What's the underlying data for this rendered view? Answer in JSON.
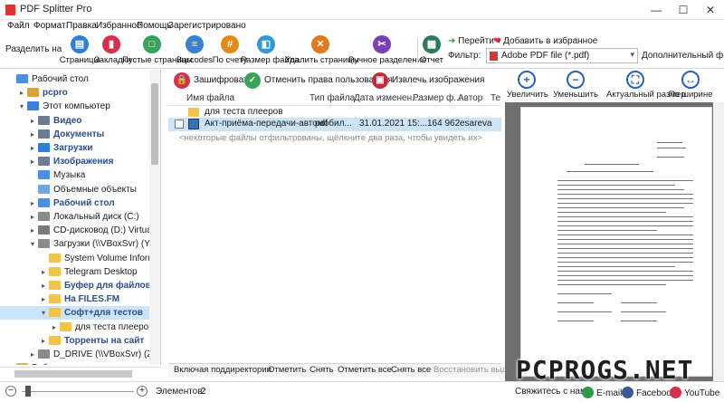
{
  "window": {
    "title": "PDF Splitter Pro"
  },
  "menu": [
    "Файл",
    "Формат",
    "Правка",
    "Избранное",
    "Помощь",
    "Зарегистрировано"
  ],
  "toolbar": {
    "split_by": "Разделить на",
    "buttons": [
      {
        "label": "Страницы",
        "color": "#2e7fd6",
        "icon": "pages-icon",
        "glyph": "▤"
      },
      {
        "label": "Закладки",
        "color": "#d8304b",
        "icon": "bookmark-icon",
        "glyph": "▮"
      },
      {
        "label": "Пустые страницы",
        "color": "#3aa35a",
        "icon": "blank-pages-icon",
        "glyph": "□"
      },
      {
        "label": "Barcodes",
        "color": "#3a7fd0",
        "icon": "barcode-icon",
        "glyph": "≡"
      },
      {
        "label": "По счету",
        "color": "#e28b1a",
        "icon": "count-icon",
        "glyph": "#"
      },
      {
        "label": "Размер файла",
        "color": "#2e9bd6",
        "icon": "file-size-icon",
        "glyph": "◧"
      },
      {
        "label": "Удалить страницы",
        "color": "#e07a1c",
        "icon": "delete-pages-icon",
        "glyph": "✕"
      },
      {
        "label": "Ручное разделение",
        "color": "#7b3fb5",
        "icon": "manual-split-icon",
        "glyph": "✂"
      },
      {
        "label": "Отчет",
        "color": "#2d7a57",
        "icon": "report-icon",
        "glyph": "▦"
      }
    ],
    "goto": "Перейти",
    "add_fav": "Добавить в избранное",
    "filter_label": "Фильтр:",
    "filter_value": "Adobe PDF file (*.pdf)",
    "advanced_filter": "Дополнительный фильтр"
  },
  "tree": [
    {
      "label": "Рабочий стол",
      "level": 0,
      "expander": "",
      "color": "#4a8fe0",
      "style": "normal"
    },
    {
      "label": "pcpro",
      "level": 1,
      "expander": "▸",
      "color": "#d9a13b",
      "style": "boldblue"
    },
    {
      "label": "Этот компьютер",
      "level": 1,
      "expander": "▾",
      "color": "#3c7fd4",
      "style": "normal"
    },
    {
      "label": "Видео",
      "level": 2,
      "expander": "▸",
      "color": "#6b7c93",
      "style": "boldblue"
    },
    {
      "label": "Документы",
      "level": 2,
      "expander": "▸",
      "color": "#6b7c93",
      "style": "boldblue"
    },
    {
      "label": "Загрузки",
      "level": 2,
      "expander": "▸",
      "color": "#2e7fd6",
      "style": "boldblue"
    },
    {
      "label": "Изображения",
      "level": 2,
      "expander": "▸",
      "color": "#6b7c93",
      "style": "boldblue"
    },
    {
      "label": "Музыка",
      "level": 2,
      "expander": "",
      "color": "#4a8fe0",
      "style": "normal"
    },
    {
      "label": "Объемные объекты",
      "level": 2,
      "expander": "",
      "color": "#6fa8dc",
      "style": "normal"
    },
    {
      "label": "Рабочий стол",
      "level": 2,
      "expander": "▸",
      "color": "#4a8fe0",
      "style": "boldblue"
    },
    {
      "label": "Локальный диск (C:)",
      "level": 2,
      "expander": "▸",
      "color": "#8a8a8a",
      "style": "normal"
    },
    {
      "label": "CD-дисковод (D:) VirtualBox Gue",
      "level": 2,
      "expander": "▸",
      "color": "#7a7a7a",
      "style": "normal"
    },
    {
      "label": "Загрузки (\\\\VBoxSvr) (Y:)",
      "level": 2,
      "expander": "▾",
      "color": "#8a8a8a",
      "style": "normal"
    },
    {
      "label": "System Volume Information",
      "level": 3,
      "expander": "",
      "color": "#f0c44a",
      "style": "normal"
    },
    {
      "label": "Telegram Desktop",
      "level": 3,
      "expander": "▸",
      "color": "#f0c44a",
      "style": "normal"
    },
    {
      "label": "Буфер для файлов",
      "level": 3,
      "expander": "▸",
      "color": "#f0c44a",
      "style": "boldblue"
    },
    {
      "label": "На FILES.FM",
      "level": 3,
      "expander": "▸",
      "color": "#f0c44a",
      "style": "boldblue"
    },
    {
      "label": "Софт+для тестов",
      "level": 3,
      "expander": "▾",
      "color": "#f0c44a",
      "style": "selected"
    },
    {
      "label": "для теста плееров",
      "level": 4,
      "expander": "▸",
      "color": "#f0c44a",
      "style": "normal"
    },
    {
      "label": "Торренты на сайт",
      "level": 3,
      "expander": "▸",
      "color": "#f0c44a",
      "style": "boldblue"
    },
    {
      "label": "D_DRIVE (\\\\VBoxSvr) (Z:)",
      "level": 2,
      "expander": "▸",
      "color": "#8a8a8a",
      "style": "normal"
    },
    {
      "label": "Библиотеки",
      "level": 0,
      "expander": "▸",
      "color": "#e0b44a",
      "style": "normal"
    }
  ],
  "actions": [
    {
      "label": "Зашифровать",
      "color": "#d8304b",
      "icon": "lock-icon",
      "glyph": "🔒"
    },
    {
      "label": "Отменить права пользователя",
      "color": "#3aa35a",
      "icon": "unlock-icon",
      "glyph": "✓"
    },
    {
      "label": "Извлечь изображения",
      "color": "#c02b3c",
      "icon": "extract-images-icon",
      "glyph": "▣"
    }
  ],
  "columns": [
    "Имя файла",
    "Тип файла",
    "Дата изменен...",
    "Размер ф...",
    "Автор",
    "Те"
  ],
  "files": [
    {
      "kind": "folder",
      "name": "для теста плееров",
      "type": "",
      "date": "",
      "size": "",
      "author": ""
    },
    {
      "kind": "pdf",
      "name": "Акт-приёма-передачи-автомобил...",
      "type": "pdf",
      "date": "31.01.2021 15:...",
      "size": "164 962",
      "author": "esareva"
    }
  ],
  "filtered_note": "<некоторые файлы отфильтрованы, щёлкните два раза, чтобы увидеть их>",
  "bottom_tabs": [
    "Включая поддиректории",
    "Отметить",
    "Снять",
    "Отметить все",
    "Снять все",
    "Восстановить выде"
  ],
  "preview": {
    "buttons": [
      {
        "label": "Увеличить",
        "glyph": "+",
        "icon": "zoom-in-icon"
      },
      {
        "label": "Уменьшить",
        "glyph": "−",
        "icon": "zoom-out-icon"
      },
      {
        "label": "Актуальный размер",
        "glyph": "⛶",
        "icon": "actual-size-icon"
      },
      {
        "label": "По ширине",
        "glyph": "↔",
        "icon": "fit-width-icon"
      }
    ]
  },
  "status": {
    "items_label": "Элементов:",
    "items_count": "2",
    "contact": "Свяжитесь с нами",
    "email": "E-mail",
    "facebook": "Facebook",
    "youtube": "YouTube"
  },
  "watermark": "PCPROGS.NET"
}
